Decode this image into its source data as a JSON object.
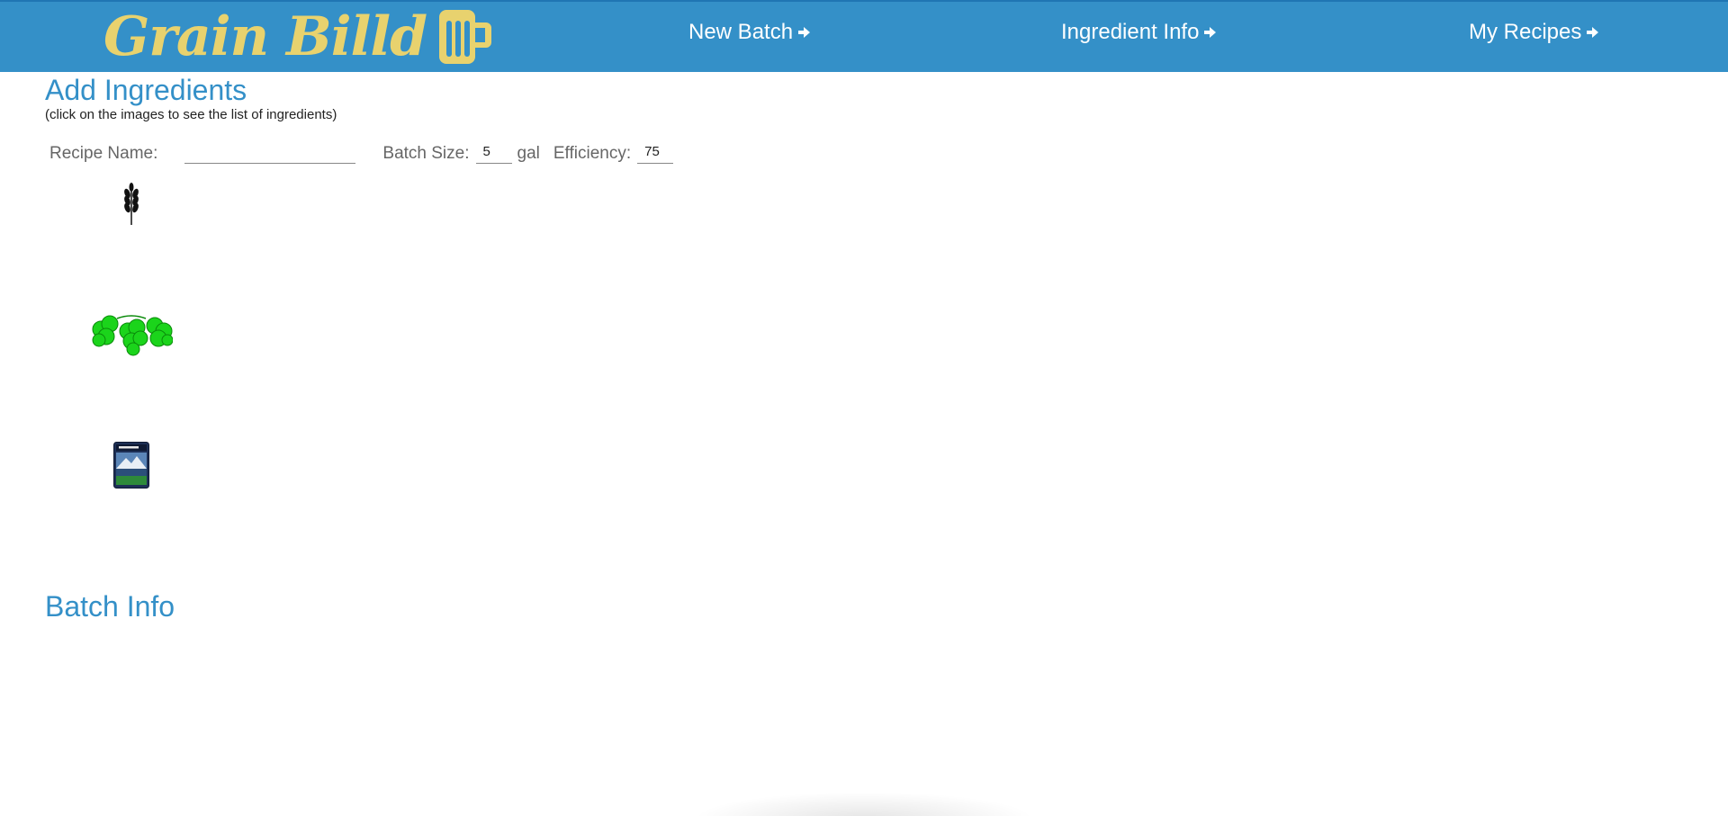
{
  "navbar": {
    "brand": "Grain Billd",
    "links": [
      {
        "label": "New Batch"
      },
      {
        "label": "Ingredient Info"
      },
      {
        "label": "My Recipes"
      }
    ],
    "brand_color": "#e8d26e",
    "bar_color": "#3490c8"
  },
  "add_ingredients": {
    "title": "Add Ingredients",
    "hint": "(click on the images to see the list of ingredients)",
    "icons": [
      "grain-icon",
      "hops-icon",
      "yeast-package-icon"
    ]
  },
  "form": {
    "recipe_name_label": "Recipe Name:",
    "recipe_name_value": "",
    "batch_size_label": "Batch Size:",
    "batch_size_value": "5",
    "batch_size_unit": "gal",
    "efficiency_label": "Efficiency:",
    "efficiency_value": "75"
  },
  "batch_info": {
    "title": "Batch Info"
  }
}
